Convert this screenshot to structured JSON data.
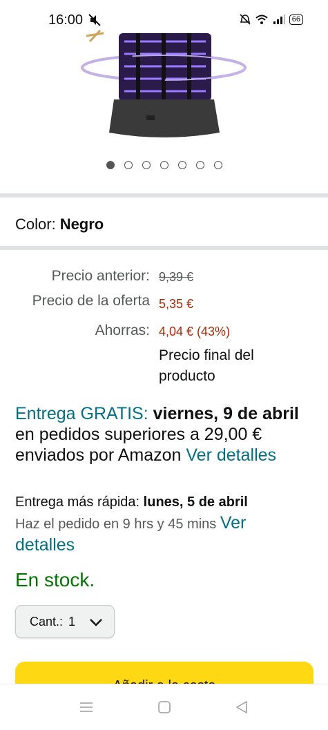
{
  "status": {
    "time": "16:00",
    "battery": "66"
  },
  "carousel": {
    "dot_count": 7,
    "active_index": 0
  },
  "variation": {
    "label": "Color:",
    "value": "Negro"
  },
  "price": {
    "previous_label": "Precio anterior:",
    "previous_value": "9,39 €",
    "deal_label": "Precio de la oferta",
    "deal_value": "5,35 €",
    "savings_label": "Ahorras:",
    "savings_value": "4,04 € (43%)",
    "final_note": "Precio final del producto"
  },
  "delivery": {
    "free_label": "Entrega GRATIS:",
    "date": "viernes, 9 de abril",
    "condition": "en pedidos superiores a 29,00 € enviados por Amazon",
    "details_link": "Ver detalles"
  },
  "fast_delivery": {
    "label": "Entrega más rápida:",
    "date": "lunes, 5 de abril",
    "order_within": "Haz el pedido en 9 hrs y 45 mins",
    "details_link": "Ver detalles"
  },
  "stock": "En stock.",
  "quantity": {
    "label": "Cant.:",
    "value": "1"
  },
  "cart_button": "Añadir a la cesta",
  "colors": {
    "teal": "#007185",
    "price_red": "#b12704",
    "stock_green": "#007600",
    "cart_yellow": "#ffd814"
  }
}
